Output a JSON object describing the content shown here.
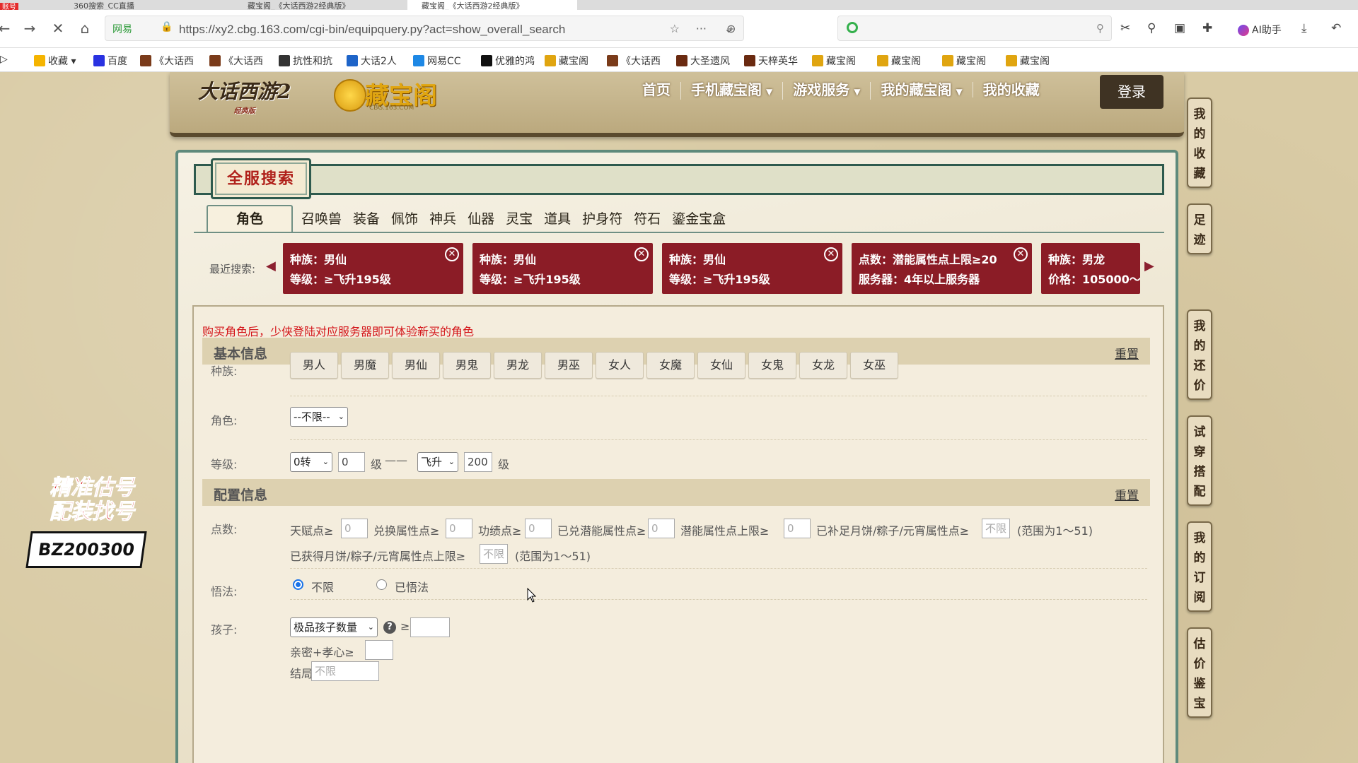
{
  "browser": {
    "tabs": [
      {
        "label": "账号",
        "active": false
      },
      {
        "label": "360搜索_CC直播",
        "active": false
      },
      {
        "label": "藏宝阁_《大话西游2经典版》",
        "active": false
      },
      {
        "label": "藏宝阁_《大话西游2经典版》",
        "active": true
      }
    ],
    "address": {
      "secure_label": "网易",
      "url": "https://xy2.cbg.163.com/cgi-bin/equipquery.py?act=show_overall_search"
    },
    "search_placeholder": "",
    "ai_helper_label": "AI助手",
    "bookmarks": [
      {
        "label": "收藏",
        "color": "#f5b400"
      },
      {
        "label": "百度",
        "color": "#2932e1"
      },
      {
        "label": "《大话西",
        "color": "#7a3b1a"
      },
      {
        "label": "《大话西",
        "color": "#7a3b1a"
      },
      {
        "label": "抗性和抗",
        "color": "#333333"
      },
      {
        "label": "大话2人",
        "color": "#1e64c8"
      },
      {
        "label": "网易CC",
        "color": "#1e88e5"
      },
      {
        "label": "优雅的鸿",
        "color": "#111111"
      },
      {
        "label": "藏宝阁",
        "color": "#e0a510"
      },
      {
        "label": "《大话西",
        "color": "#7a3b1a"
      },
      {
        "label": "大圣遗风",
        "color": "#6a2a10"
      },
      {
        "label": "天梓英华",
        "color": "#6a2a10"
      },
      {
        "label": "藏宝阁",
        "color": "#e0a510"
      },
      {
        "label": "藏宝阁",
        "color": "#e0a510"
      },
      {
        "label": "藏宝阁",
        "color": "#e0a510"
      },
      {
        "label": "藏宝阁",
        "color": "#e0a510"
      }
    ]
  },
  "site": {
    "game_logo": "大话西游2",
    "game_logo_sub": "经典版",
    "cbg_logo": "藏宝阁",
    "cbg_domain": "CBG.163.COM",
    "nav": [
      {
        "label": "首页",
        "dropdown": false
      },
      {
        "label": "手机藏宝阁",
        "dropdown": true
      },
      {
        "label": "游戏服务",
        "dropdown": true
      },
      {
        "label": "我的藏宝阁",
        "dropdown": true
      },
      {
        "label": "我的收藏",
        "dropdown": false
      }
    ],
    "login_label": "登录",
    "side_rail": [
      "我的收藏",
      "足迹",
      "我的还价",
      "试穿搭配",
      "我的订阅",
      "估价鉴宝"
    ]
  },
  "promo": {
    "line1": "精准估号",
    "line2": "配装找号",
    "code": "BZ200300"
  },
  "search": {
    "title": "全服搜索",
    "categories": [
      "角色",
      "召唤兽",
      "装备",
      "佩饰",
      "神兵",
      "仙器",
      "灵宝",
      "道具",
      "护身符",
      "符石",
      "鎏金宝盒"
    ],
    "active_category": "角色",
    "recent_label": "最近搜索:",
    "recent": [
      {
        "l1": "种族：男仙",
        "l2": "等级：≥飞升195级"
      },
      {
        "l1": "种族：男仙",
        "l2": "等级：≥飞升195级"
      },
      {
        "l1": "种族：男仙",
        "l2": "等级：≥飞升195级"
      },
      {
        "l1": "点数：潜能属性点上限≥20",
        "l2": "服务器：4年以上服务器"
      },
      {
        "l1": "种族：男龙",
        "l2": "价格：105000～"
      }
    ],
    "notice": "购买角色后，少侠登陆对应服务器即可体验新买的角色",
    "basic": {
      "title": "基本信息",
      "reset": "重置",
      "race_label": "种族:",
      "races": [
        "男人",
        "男魔",
        "男仙",
        "男鬼",
        "男龙",
        "男巫",
        "女人",
        "女魔",
        "女仙",
        "女鬼",
        "女龙",
        "女巫"
      ],
      "role_label": "角色:",
      "role_value": "--不限--",
      "level_label": "等级:",
      "level_from_turn": "0转",
      "level_from": "0",
      "level_unit": "级",
      "level_sep": "——",
      "level_to_turn": "飞升",
      "level_to": "200",
      "level_unit2": "级"
    },
    "config": {
      "title": "配置信息",
      "reset": "重置",
      "points_label": "点数:",
      "points": [
        {
          "label": "天赋点≥",
          "value": "0"
        },
        {
          "label": "兑换属性点≥",
          "value": "0"
        },
        {
          "label": "功绩点≥",
          "value": "0"
        },
        {
          "label": "已兑潜能属性点≥",
          "value": "0"
        },
        {
          "label": "潜能属性点上限≥",
          "value": "0"
        },
        {
          "label": "已补足月饼/粽子/元宵属性点≥",
          "value": "不限"
        }
      ],
      "range_note": "(范围为1～51)",
      "points2_label": "已获得月饼/粽子/元宵属性点上限≥",
      "points2_value": "不限",
      "range_note2": "(范围为1～51)",
      "wufa_label": "悟法:",
      "wufa_opt1": "不限",
      "wufa_opt2": "已悟法",
      "child_label": "孩子:",
      "child_select": "极品孩子数量",
      "child_ge": "≥",
      "child_value": "",
      "intimacy_label": "亲密+孝心≥",
      "intimacy_value": "",
      "ending_label": "结局",
      "ending_value": "不限"
    }
  }
}
